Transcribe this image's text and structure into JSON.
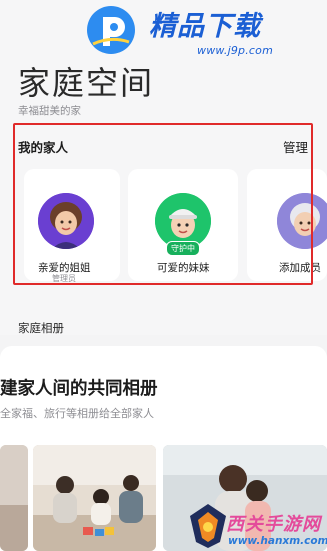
{
  "watermark_top": {
    "brand": "精品下载",
    "url": "www.j9p.com"
  },
  "header": {
    "title": "家庭空间",
    "subtitle": "幸福甜美的家"
  },
  "family": {
    "title": "我的家人",
    "manage_label": "管理",
    "members": [
      {
        "name": "亲爱的姐姐",
        "role": "管理员"
      },
      {
        "name": "可爱的妹妹",
        "badge": "守护中"
      },
      {
        "name": "添加成员"
      }
    ]
  },
  "album": {
    "section_label": "家庭相册",
    "headline": "建家人间的共同相册",
    "description": "全家福、旅行等相册给全部家人"
  },
  "watermark_bottom": {
    "brand": "西关手游网",
    "url": "www.hanxm.com"
  },
  "colors": {
    "highlight_border": "#e02a2a",
    "accent_green": "#17b05c",
    "avatar_purple": "#6a3fd1",
    "watermark_blue": "#1b5fd4"
  }
}
